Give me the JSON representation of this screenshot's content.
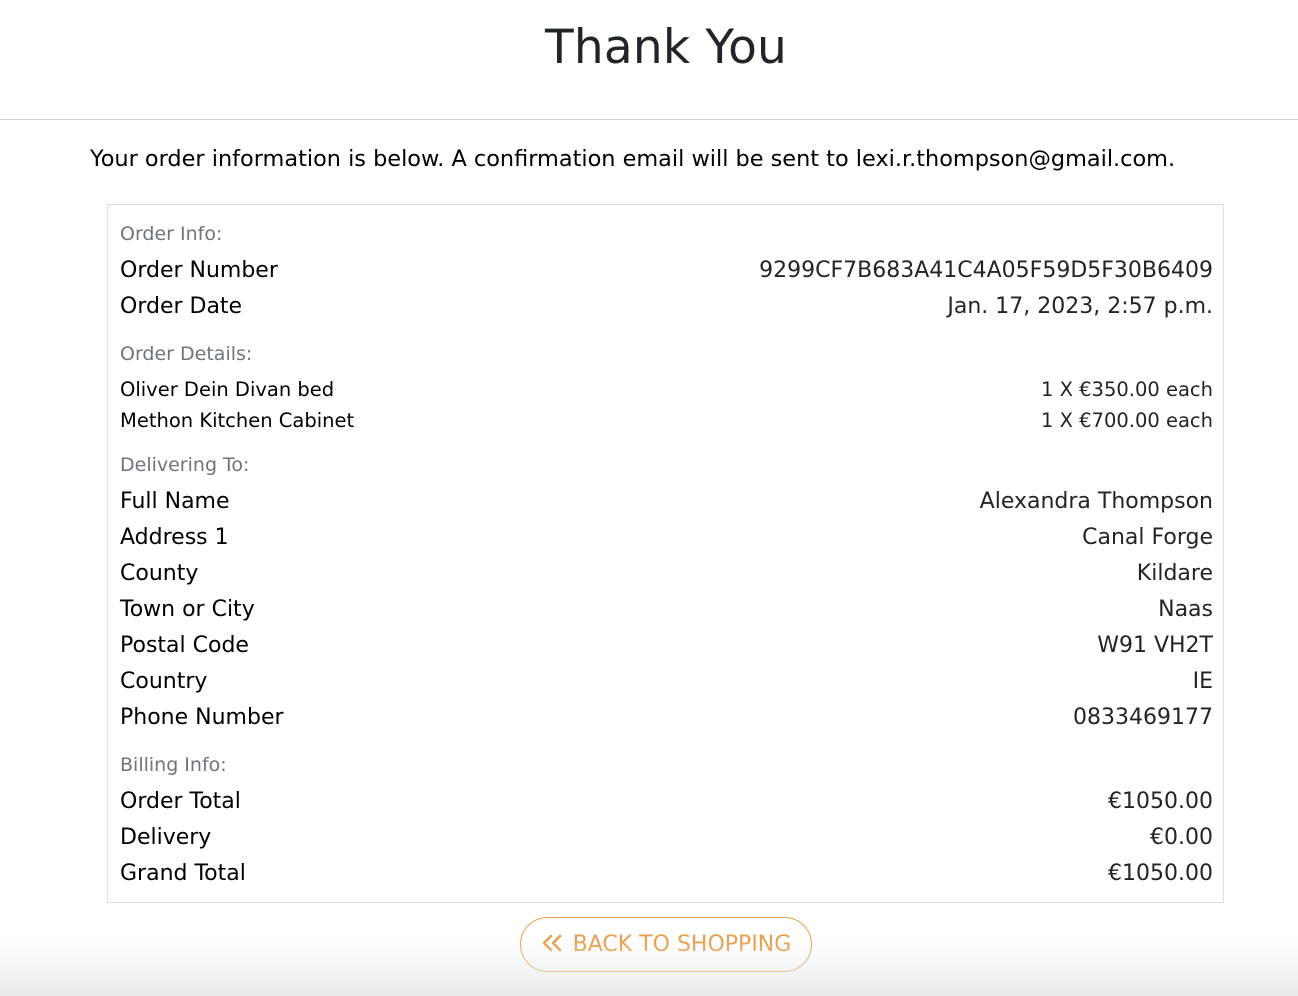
{
  "header": {
    "title": "Thank You"
  },
  "intro": {
    "text": "Your order information is below. A confirmation email will be sent to ",
    "email": "lexi.r.thompson@gmail.com",
    "suffix": "."
  },
  "order_info": {
    "heading": "Order Info:",
    "rows": [
      {
        "label": "Order Number",
        "value": "9299CF7B683A41C4A05F59D5F30B6409"
      },
      {
        "label": "Order Date",
        "value": "Jan. 17, 2023, 2:57 p.m."
      }
    ]
  },
  "order_details": {
    "heading": "Order Details:",
    "items": [
      {
        "name": "Oliver Dein Divan bed",
        "qty_price": "1 X €350.00 each"
      },
      {
        "name": "Methon Kitchen Cabinet",
        "qty_price": "1 X €700.00 each"
      }
    ]
  },
  "delivering_to": {
    "heading": "Delivering To:",
    "rows": [
      {
        "label": "Full Name",
        "value": "Alexandra Thompson"
      },
      {
        "label": "Address 1",
        "value": "Canal Forge"
      },
      {
        "label": "County",
        "value": "Kildare"
      },
      {
        "label": "Town or City",
        "value": "Naas"
      },
      {
        "label": "Postal Code",
        "value": "W91 VH2T"
      },
      {
        "label": "Country",
        "value": "IE"
      },
      {
        "label": "Phone Number",
        "value": "0833469177"
      }
    ]
  },
  "billing_info": {
    "heading": "Billing Info:",
    "rows": [
      {
        "label": "Order Total",
        "value": "€1050.00"
      },
      {
        "label": "Delivery",
        "value": "€0.00"
      },
      {
        "label": "Grand Total",
        "value": "€1050.00"
      }
    ]
  },
  "actions": {
    "back_label": "BACK TO SHOPPING",
    "back_icon": "double-chevron-left-icon"
  },
  "colors": {
    "accent": "#e8a04c",
    "muted_label": "#6c757d",
    "border": "#dcdfe2"
  }
}
